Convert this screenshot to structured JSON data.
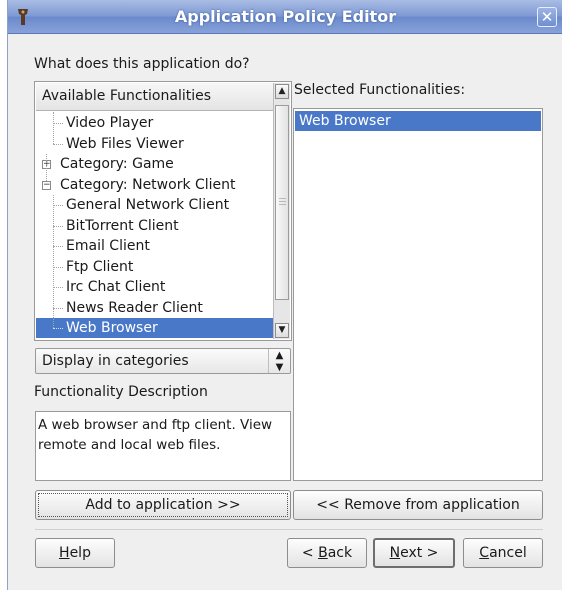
{
  "window": {
    "title": "Application Policy Editor",
    "close_glyph": "✕",
    "icon": "app-tag-icon"
  },
  "question_label": "What does this application do?",
  "available": {
    "header": "Available Functionalities",
    "items": [
      {
        "label": "Video Player",
        "level": 1
      },
      {
        "label": "Web Files Viewer",
        "level": 1
      },
      {
        "label": "Category: Game",
        "level": 0,
        "expander": "+"
      },
      {
        "label": "Category: Network Client",
        "level": 0,
        "expander": "−"
      },
      {
        "label": "General Network Client",
        "level": 1
      },
      {
        "label": "BitTorrent Client",
        "level": 1
      },
      {
        "label": "Email Client",
        "level": 1
      },
      {
        "label": "Ftp Client",
        "level": 1
      },
      {
        "label": "Irc Chat Client",
        "level": 1
      },
      {
        "label": "News Reader Client",
        "level": 1
      },
      {
        "label": "Web Browser",
        "level": 1,
        "selected": true
      }
    ],
    "scroll_up_glyph": "▲",
    "scroll_down_glyph": "▼"
  },
  "display_mode": {
    "selected": "Display in categories",
    "arrow_glyph": "⬍"
  },
  "description": {
    "label": "Functionality Description",
    "text": "A web browser and ftp client. View remote and local web files."
  },
  "selected": {
    "label": "Selected Functionalities:",
    "items": [
      "Web Browser"
    ]
  },
  "buttons": {
    "add": "Add to application >>",
    "remove": "<< Remove from application",
    "help": {
      "mnemonic": "H",
      "rest": "elp"
    },
    "back": {
      "prefix": "< ",
      "mnemonic": "B",
      "rest": "ack"
    },
    "next": {
      "mnemonic": "N",
      "rest": "ext >"
    },
    "cancel": {
      "mnemonic": "C",
      "rest": "ancel"
    }
  },
  "colors": {
    "selection": "#4a78c9",
    "titlebar": "#7d98d3"
  }
}
